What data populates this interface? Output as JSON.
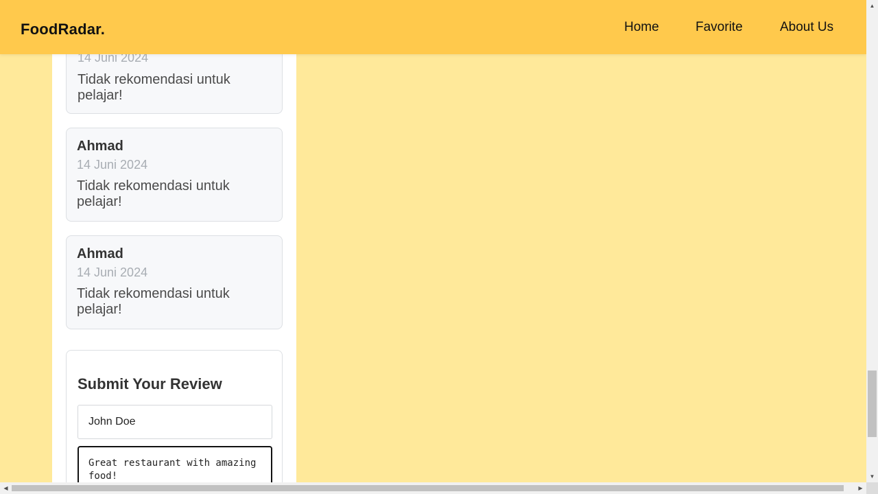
{
  "header": {
    "brand": "FoodRadar.",
    "nav": [
      "Home",
      "Favorite",
      "About Us"
    ]
  },
  "reviews": [
    {
      "name": "Ahmad",
      "date": "14 Juni 2024",
      "text": "Tidak rekomendasi untuk pelajar!"
    },
    {
      "name": "Ahmad",
      "date": "14 Juni 2024",
      "text": "Tidak rekomendasi untuk pelajar!"
    },
    {
      "name": "Ahmad",
      "date": "14 Juni 2024",
      "text": "Tidak rekomendasi untuk pelajar!"
    }
  ],
  "review_form": {
    "title": "Submit Your Review",
    "name_value": "John Doe",
    "review_value": "Great restaurant with amazing food!"
  },
  "colors": {
    "header_bg": "#ffc94c",
    "page_bg": "#ffe99a"
  },
  "scrollbars": {
    "vertical_position_fraction": 0.82,
    "horizontal_position_fraction": 0.0
  }
}
